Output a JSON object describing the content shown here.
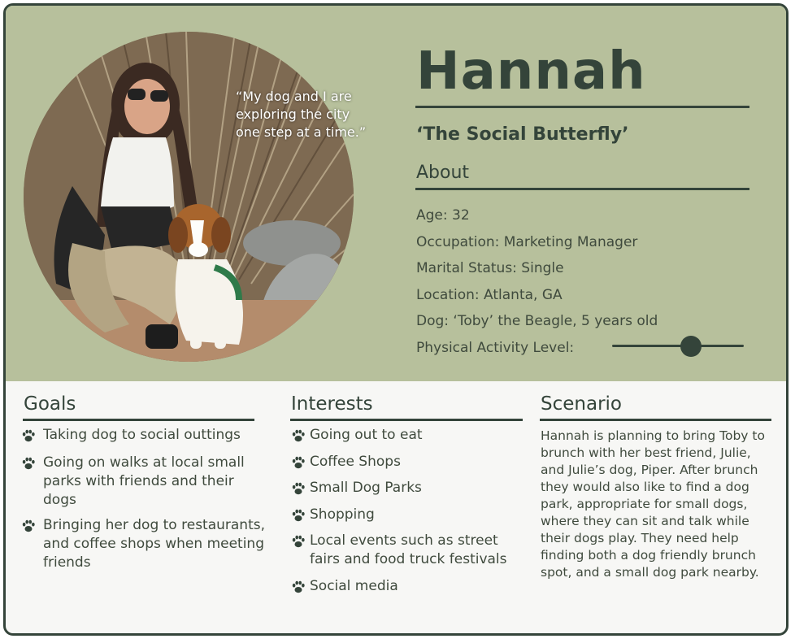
{
  "persona": {
    "name": "Hannah",
    "nickname": "‘The Social Butterfly’",
    "quote": "“My dog and I are\nexploring the city\none step at a time.”",
    "about_heading": "About",
    "facts": {
      "age": "Age: 32",
      "occupation": "Occupation: Marketing Manager",
      "marital": "Marital Status: Single",
      "location": "Location: Atlanta, GA",
      "dog": "Dog: ‘Toby’ the Beagle, 5 years old",
      "activity_label": "Physical Activity Level:"
    },
    "activity_level": 0.6
  },
  "goals": {
    "heading": "Goals",
    "items": [
      "Taking dog to social outtings",
      "Going on walks at local small parks with friends and their dogs",
      "Bringing her dog to restaurants, and coffee shops when meeting friends"
    ]
  },
  "interests": {
    "heading": "Interests",
    "items": [
      "Going out to eat",
      "Coffee Shops",
      "Small Dog Parks",
      "Shopping",
      "Local events such as street fairs and food truck festivals",
      "Social media"
    ]
  },
  "scenario": {
    "heading": "Scenario",
    "text": "Hannah is planning to bring Toby to brunch with her best friend, Julie, and Julie’s dog, Piper. After brunch they would also like to find a dog park, appropriate for small dogs, where they can sit and talk while their dogs play.  They need help finding both a dog friendly brunch spot, and a small dog park nearby."
  },
  "colors": {
    "top_panel": "#b7c09c",
    "accent_dark": "#34443a",
    "bottom_panel": "#f7f7f5"
  },
  "icons": {
    "bullet": "paw-print-icon"
  }
}
